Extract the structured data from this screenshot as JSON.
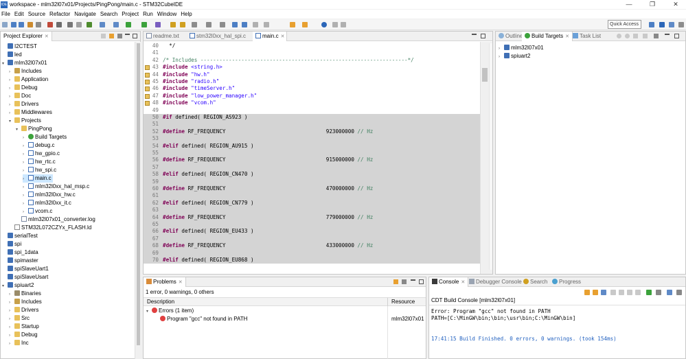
{
  "window": {
    "title": "workspace - mlm32l07x01/Projects/PingPong/main.c - STM32CubeIDE",
    "app_icon": "IDE"
  },
  "menu": [
    "File",
    "Edit",
    "Source",
    "Refactor",
    "Navigate",
    "Search",
    "Project",
    "Run",
    "Window",
    "Help"
  ],
  "quick_access": "Quick Access",
  "project_explorer": {
    "tab_label": "Project Explorer",
    "items": [
      {
        "label": "I2CTEST",
        "icon": "project-icon",
        "indent": 0,
        "arrow": ""
      },
      {
        "label": "led",
        "icon": "project-icon",
        "indent": 0,
        "arrow": ""
      },
      {
        "label": "mlm32l07x01",
        "icon": "project-icon",
        "indent": 0,
        "arrow": "▾"
      },
      {
        "label": "Includes",
        "icon": "includes-icon",
        "indent": 1,
        "arrow": "›"
      },
      {
        "label": "Application",
        "icon": "folder-icon",
        "indent": 1,
        "arrow": "›"
      },
      {
        "label": "Debug",
        "icon": "folder-icon",
        "indent": 1,
        "arrow": "›"
      },
      {
        "label": "Doc",
        "icon": "folder-icon",
        "indent": 1,
        "arrow": "›"
      },
      {
        "label": "Drivers",
        "icon": "folder-icon",
        "indent": 1,
        "arrow": "›"
      },
      {
        "label": "Middlewares",
        "icon": "folder-icon",
        "indent": 1,
        "arrow": "›"
      },
      {
        "label": "Projects",
        "icon": "folder-icon",
        "indent": 1,
        "arrow": "▾"
      },
      {
        "label": "PingPong",
        "icon": "folder-icon",
        "indent": 2,
        "arrow": "▾"
      },
      {
        "label": "Build Targets",
        "icon": "build-target-icon",
        "indent": 3,
        "arrow": "›"
      },
      {
        "label": "debug.c",
        "icon": "c-file-icon",
        "indent": 3,
        "arrow": "›"
      },
      {
        "label": "hw_gpio.c",
        "icon": "c-file-icon",
        "indent": 3,
        "arrow": "›"
      },
      {
        "label": "hw_rtc.c",
        "icon": "c-file-icon",
        "indent": 3,
        "arrow": "›"
      },
      {
        "label": "hw_spi.c",
        "icon": "c-file-icon",
        "indent": 3,
        "arrow": "›"
      },
      {
        "label": "main.c",
        "icon": "c-file-icon",
        "indent": 3,
        "arrow": "›",
        "selected": true
      },
      {
        "label": "mlm32l0xx_hal_msp.c",
        "icon": "c-file-icon",
        "indent": 3,
        "arrow": "›"
      },
      {
        "label": "mlm32l0xx_hw.c",
        "icon": "c-file-icon",
        "indent": 3,
        "arrow": "›"
      },
      {
        "label": "mlm32l0xx_it.c",
        "icon": "c-file-icon",
        "indent": 3,
        "arrow": "›"
      },
      {
        "label": "vcom.c",
        "icon": "c-file-icon",
        "indent": 3,
        "arrow": "›"
      },
      {
        "label": "mlm32l07x01_converter.log",
        "icon": "file-icon",
        "indent": 2,
        "arrow": ""
      },
      {
        "label": "STM32L072CZYx_FLASH.ld",
        "icon": "linker-file-icon",
        "indent": 1,
        "arrow": ""
      },
      {
        "label": "serialTest",
        "icon": "project-icon",
        "indent": 0,
        "arrow": ""
      },
      {
        "label": "spi",
        "icon": "project-icon",
        "indent": 0,
        "arrow": ""
      },
      {
        "label": "spi_1data",
        "icon": "project-icon",
        "indent": 0,
        "arrow": ""
      },
      {
        "label": "spimaster",
        "icon": "project-icon",
        "indent": 0,
        "arrow": ""
      },
      {
        "label": "spiSlaveUart1",
        "icon": "project-icon",
        "indent": 0,
        "arrow": ""
      },
      {
        "label": "spiSlaveUsart",
        "icon": "project-icon",
        "indent": 0,
        "arrow": ""
      },
      {
        "label": "spiuart2",
        "icon": "project-icon",
        "indent": 0,
        "arrow": "▾"
      },
      {
        "label": "Binaries",
        "icon": "binaries-icon",
        "indent": 1,
        "arrow": "›"
      },
      {
        "label": "Includes",
        "icon": "includes-icon",
        "indent": 1,
        "arrow": "›"
      },
      {
        "label": "Drivers",
        "icon": "folder-icon",
        "indent": 1,
        "arrow": "›"
      },
      {
        "label": "Src",
        "icon": "folder-icon",
        "indent": 1,
        "arrow": "›"
      },
      {
        "label": "Startup",
        "icon": "folder-icon",
        "indent": 1,
        "arrow": "›"
      },
      {
        "label": "Debug",
        "icon": "folder-icon",
        "indent": 1,
        "arrow": "›"
      },
      {
        "label": "Inc",
        "icon": "folder-icon",
        "indent": 1,
        "arrow": "›"
      }
    ]
  },
  "editor": {
    "tabs": [
      {
        "label": "readme.txt",
        "active": false
      },
      {
        "label": "stm32l0xx_hal_spi.c",
        "active": false
      },
      {
        "label": "main.c",
        "active": true
      }
    ],
    "lines": [
      {
        "n": "40",
        "text": "  */",
        "type": "plain"
      },
      {
        "n": "41",
        "text": "",
        "type": "plain"
      },
      {
        "n": "42",
        "text": "/* Includes ------------------------------------------------------------------*/",
        "type": "comment"
      },
      {
        "n": "43",
        "kw": "#include",
        "rest": " <string.h>",
        "type": "include",
        "mark": true
      },
      {
        "n": "44",
        "kw": "#include",
        "rest": " \"hw.h\"",
        "type": "include",
        "mark": true
      },
      {
        "n": "45",
        "kw": "#include",
        "rest": " \"radio.h\"",
        "type": "include",
        "mark": true
      },
      {
        "n": "46",
        "kw": "#include",
        "rest": " \"timeServer.h\"",
        "type": "include",
        "mark": true
      },
      {
        "n": "47",
        "kw": "#include",
        "rest": " \"low_power_manager.h\"",
        "type": "include",
        "mark": true
      },
      {
        "n": "48",
        "kw": "#include",
        "rest": " \"vcom.h\"",
        "type": "include",
        "mark": true
      },
      {
        "n": "49",
        "text": "",
        "type": "plain"
      },
      {
        "n": "50",
        "kw": "#if",
        "rest": " defined( REGION_AS923 )",
        "type": "directive",
        "dim": true
      },
      {
        "n": "51",
        "text": "",
        "type": "plain",
        "dim": true
      },
      {
        "n": "52",
        "kw": "#define",
        "rest": " RF_FREQUENCY                                923000000",
        "cmt": " // Hz",
        "type": "define",
        "dim": true
      },
      {
        "n": "53",
        "text": "",
        "type": "plain",
        "dim": true
      },
      {
        "n": "54",
        "kw": "#elif",
        "rest": " defined( REGION_AU915 )",
        "type": "directive",
        "dim": true
      },
      {
        "n": "55",
        "text": "",
        "type": "plain",
        "dim": true
      },
      {
        "n": "56",
        "kw": "#define",
        "rest": " RF_FREQUENCY                                915000000",
        "cmt": " // Hz",
        "type": "define",
        "dim": true
      },
      {
        "n": "57",
        "text": "",
        "type": "plain",
        "dim": true
      },
      {
        "n": "58",
        "kw": "#elif",
        "rest": " defined( REGION_CN470 )",
        "type": "directive",
        "dim": true
      },
      {
        "n": "59",
        "text": "",
        "type": "plain",
        "dim": true
      },
      {
        "n": "60",
        "kw": "#define",
        "rest": " RF_FREQUENCY                                470000000",
        "cmt": " // Hz",
        "type": "define",
        "dim": true
      },
      {
        "n": "61",
        "text": "",
        "type": "plain",
        "dim": true
      },
      {
        "n": "62",
        "kw": "#elif",
        "rest": " defined( REGION_CN779 )",
        "type": "directive",
        "dim": true
      },
      {
        "n": "63",
        "text": "",
        "type": "plain",
        "dim": true
      },
      {
        "n": "64",
        "kw": "#define",
        "rest": " RF_FREQUENCY                                779000000",
        "cmt": " // Hz",
        "type": "define",
        "dim": true
      },
      {
        "n": "65",
        "text": "",
        "type": "plain",
        "dim": true
      },
      {
        "n": "66",
        "kw": "#elif",
        "rest": " defined( REGION_EU433 )",
        "type": "directive",
        "dim": true
      },
      {
        "n": "67",
        "text": "",
        "type": "plain",
        "dim": true
      },
      {
        "n": "68",
        "kw": "#define",
        "rest": " RF_FREQUENCY                                433000000",
        "cmt": " // Hz",
        "type": "define",
        "dim": true
      },
      {
        "n": "69",
        "text": "",
        "type": "plain",
        "dim": true
      },
      {
        "n": "70",
        "kw": "#elif",
        "rest": " defined( REGION_EU868 )",
        "type": "directive",
        "dim": true
      }
    ]
  },
  "outline": {
    "tabs": [
      {
        "label": "Outline",
        "active": false
      },
      {
        "label": "Build Targets",
        "active": true
      },
      {
        "label": "Task List",
        "active": false
      }
    ],
    "items": [
      "mlm32l07x01",
      "spiuart2"
    ]
  },
  "problems": {
    "tab_label": "Problems",
    "summary": "1 error, 0 warnings, 0 others",
    "col_description": "Description",
    "col_resource": "Resource",
    "group": "Errors (1 item)",
    "error_text": "Program \"gcc\" not found in PATH",
    "error_resource": "mlm32l07x01"
  },
  "console": {
    "tabs": [
      {
        "label": "Console",
        "active": true
      },
      {
        "label": "Debugger Console",
        "active": false
      },
      {
        "label": "Search",
        "active": false
      },
      {
        "label": "Progress",
        "active": false
      }
    ],
    "header": "CDT Build Console [mlm32l07x01]",
    "line1": "Error: Program \"gcc\" not found in PATH",
    "line2": "PATH=[C:\\MinGW\\bin;\\bin;\\usr\\bin;C:\\MinGW\\bin]",
    "line3": "17:41:15 Build Finished. 0 errors, 0 warnings. (took 154ms)"
  },
  "colors": {
    "keyword": "#7f0055",
    "string": "#2a00ff",
    "comment": "#3f7f5f",
    "build_finished": "#1f5fbf",
    "error": "#e04040"
  }
}
